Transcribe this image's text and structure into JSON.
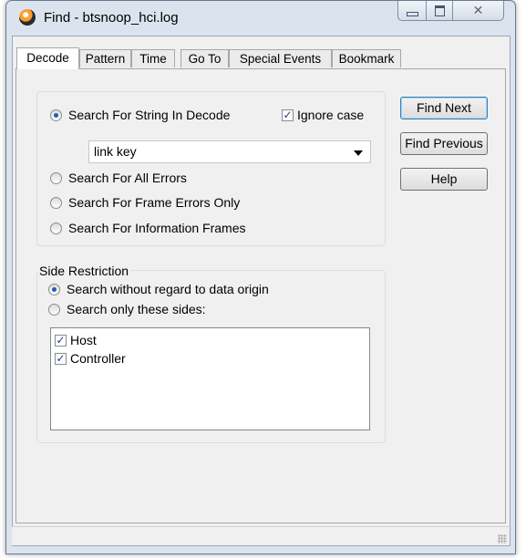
{
  "window": {
    "title": "Find - btsnoop_hci.log"
  },
  "tabs": [
    {
      "label": "Decode"
    },
    {
      "label": "Pattern"
    },
    {
      "label": "Time"
    },
    {
      "label": "Go To"
    },
    {
      "label": "Special Events"
    },
    {
      "label": "Bookmark"
    }
  ],
  "search": {
    "string_in_decode_label": "Search For String In Decode",
    "ignore_case_label": "Ignore case",
    "ignore_case_checked": true,
    "query_value": "link key",
    "all_errors_label": "Search For All Errors",
    "frame_errors_label": "Search For Frame Errors Only",
    "info_frames_label": "Search For Information Frames",
    "selected_option": "string_in_decode"
  },
  "side_restriction": {
    "group_label": "Side Restriction",
    "without_regard_label": "Search without regard to data origin",
    "only_these_label": "Search only these sides:",
    "selected_option": "without_regard",
    "sides": [
      {
        "label": "Host",
        "checked": true
      },
      {
        "label": "Controller",
        "checked": true
      }
    ]
  },
  "buttons": {
    "find_next": "Find Next",
    "find_previous": "Find Previous",
    "help": "Help"
  },
  "colors": {
    "radio_selected": "#1e5fb3",
    "default_button_border": "#3c7fb1"
  }
}
